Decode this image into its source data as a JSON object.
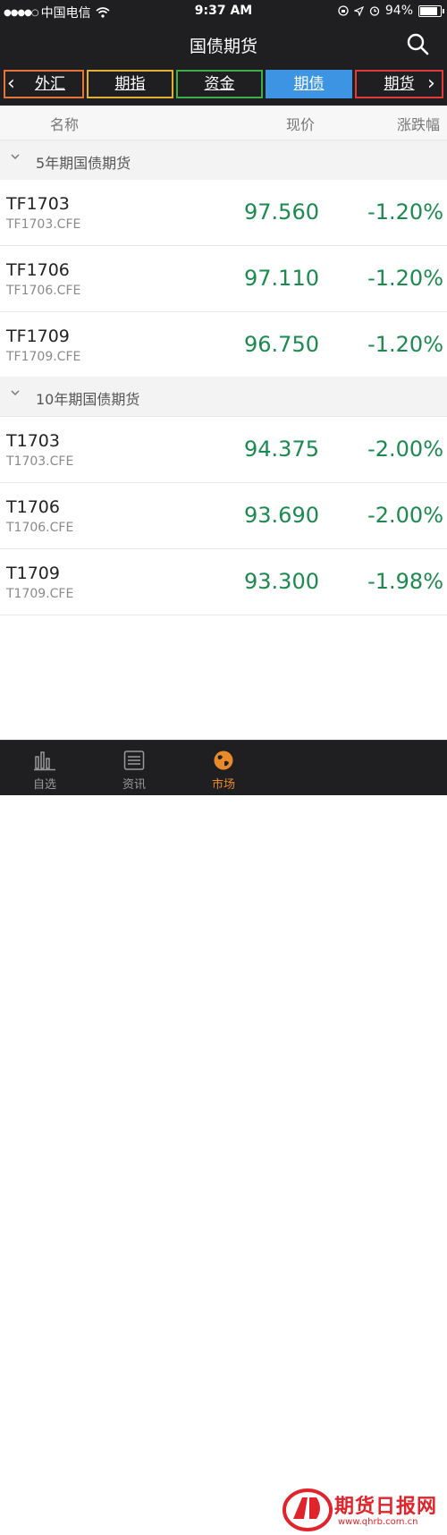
{
  "status_bar": {
    "carrier": "中国电信",
    "time": "9:37 AM",
    "battery": "94%",
    "battery_level": 0.94
  },
  "nav": {
    "title": "国债期货",
    "search_icon": "search-icon"
  },
  "tabs": [
    {
      "label": "外汇",
      "border": "#e5743a"
    },
    {
      "label": "期指",
      "border": "#e2b133"
    },
    {
      "label": "资金",
      "border": "#3fae49"
    },
    {
      "label": "期债",
      "border": "#3c94e3",
      "active": true
    },
    {
      "label": "期货",
      "border": "#e23a3a"
    }
  ],
  "columns": {
    "name": "名称",
    "price": "现价",
    "change": "涨跌幅"
  },
  "groups": [
    {
      "title": "5年期国债期货",
      "rows": [
        {
          "name": "TF1703",
          "code": "TF1703.CFE",
          "price": "97.560",
          "change": "-1.20%"
        },
        {
          "name": "TF1706",
          "code": "TF1706.CFE",
          "price": "97.110",
          "change": "-1.20%"
        },
        {
          "name": "TF1709",
          "code": "TF1709.CFE",
          "price": "96.750",
          "change": "-1.20%"
        }
      ]
    },
    {
      "title": "10年期国债期货",
      "rows": [
        {
          "name": "T1703",
          "code": "T1703.CFE",
          "price": "94.375",
          "change": "-2.00%"
        },
        {
          "name": "T1706",
          "code": "T1706.CFE",
          "price": "93.690",
          "change": "-2.00%"
        },
        {
          "name": "T1709",
          "code": "T1709.CFE",
          "price": "93.300",
          "change": "-1.98%"
        }
      ]
    }
  ],
  "tab_bar": [
    {
      "label": "自选",
      "icon": "chart-bars-icon"
    },
    {
      "label": "资讯",
      "icon": "news-list-icon"
    },
    {
      "label": "市场",
      "icon": "globe-icon",
      "active": true
    }
  ],
  "watermark": {
    "text": "期货日报网",
    "url": "www.qhrb.com.cn"
  },
  "colors": {
    "down_green": "#1c8a4f",
    "active_tab_blue": "#3c94e3",
    "active_bottom_orange": "#e88a2a"
  }
}
